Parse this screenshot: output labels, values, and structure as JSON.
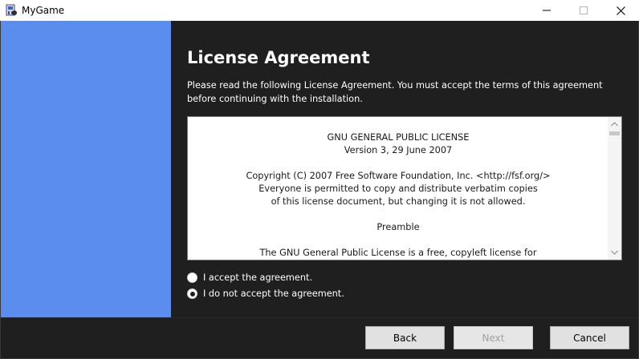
{
  "window": {
    "title": "MyGame",
    "icon": "installer-disk-icon"
  },
  "colors": {
    "sidebar": "#5b8dee",
    "content_bg": "#1f1f1f",
    "license_bg": "#ffffff"
  },
  "page": {
    "heading": "License Agreement",
    "intro": "Please read the following License Agreement. You must accept the terms of this agreement before continuing with the installation."
  },
  "license": {
    "lines": [
      "GNU GENERAL PUBLIC LICENSE",
      "Version 3, 29 June 2007",
      "",
      "Copyright (C) 2007 Free Software Foundation, Inc. <http://fsf.org/>",
      "Everyone is permitted to copy and distribute verbatim copies",
      "of this license document, but changing it is not allowed.",
      "",
      "Preamble",
      "",
      "The GNU General Public License is a free, copyleft license for"
    ]
  },
  "options": {
    "accept_label": "I accept the agreement.",
    "decline_label": "I do not accept the agreement.",
    "selected": "decline"
  },
  "buttons": {
    "back": "Back",
    "next": "Next",
    "cancel": "Cancel",
    "next_enabled": false
  }
}
